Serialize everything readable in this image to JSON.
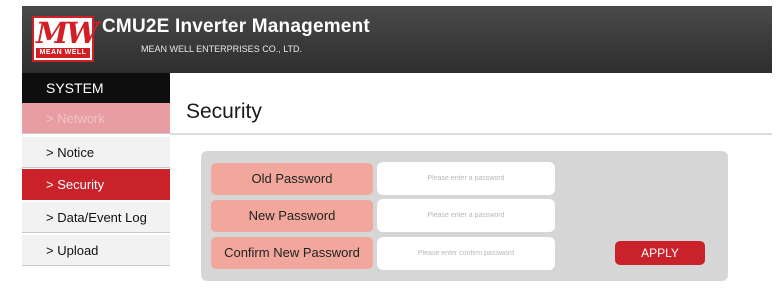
{
  "header": {
    "logo_text": "MW",
    "logo_subtext": "MEAN WELL",
    "title": "CMU2E Inverter Management",
    "company": "MEAN WELL ENTERPRISES CO., LTD."
  },
  "sidebar": {
    "heading": "SYSTEM",
    "items": [
      {
        "label": "> Network",
        "state": "dim"
      },
      {
        "label": "> Notice",
        "state": "normal"
      },
      {
        "label": "> Security",
        "state": "active"
      },
      {
        "label": "> Data/Event Log",
        "state": "normal"
      },
      {
        "label": "> Upload",
        "state": "normal"
      }
    ]
  },
  "main": {
    "title": "Security",
    "fields": [
      {
        "label": "Old Password",
        "placeholder": "Please enter a password",
        "value": ""
      },
      {
        "label": "New Password",
        "placeholder": "Please enter a password",
        "value": ""
      },
      {
        "label": "Confirm New Password",
        "placeholder": "Please enter confirm password",
        "value": ""
      }
    ],
    "apply_label": "APPLY"
  },
  "colors": {
    "brand_red": "#c9222a",
    "label_salmon": "#f1a79c",
    "header_dark": "#3a3a3a"
  }
}
